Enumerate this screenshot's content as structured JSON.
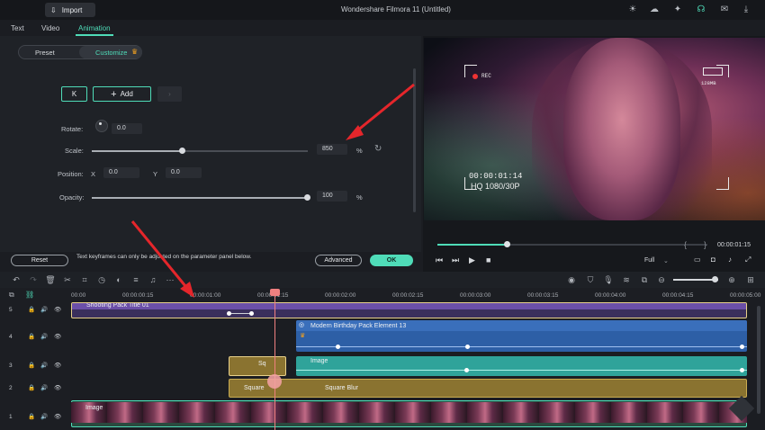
{
  "app": {
    "title": "Wondershare Filmora 11 (Untitled)",
    "import_label": "Import"
  },
  "top_tabs": [
    "Text",
    "Video",
    "Animation"
  ],
  "sub_tabs": {
    "preset": "Preset",
    "customize": "Customize"
  },
  "keyframe": {
    "prev_glyph": "K",
    "add_label": "Add",
    "next_glyph": "›"
  },
  "params": {
    "rotate_label": "Rotate:",
    "rotate_value": "0.0",
    "scale_label": "Scale:",
    "scale_value": "850",
    "scale_unit": "%",
    "position_label": "Position:",
    "x_label": "X",
    "x_value": "0.0",
    "y_label": "Y",
    "y_value": "0.0",
    "opacity_label": "Opacity:",
    "opacity_value": "100",
    "opacity_unit": "%"
  },
  "footer": {
    "reset_label": "Reset",
    "hint": "Text keyframes can only be adjusted on the parameter panel below.",
    "advanced_label": "Advanced",
    "ok_label": "OK"
  },
  "preview": {
    "rec": "REC",
    "timecode": "00:00:01:14",
    "quality": "HQ 1080/30P",
    "battery": "128MB",
    "current_time": "00:00:01:15",
    "zoom": "Full",
    "progress": 0.26
  },
  "ruler": [
    "00:00",
    "00:00:00:15",
    "00:00:01:00",
    "00:00:01:15",
    "00:00:02:00",
    "00:00:02:15",
    "00:00:03:00",
    "00:00:03:15",
    "00:00:04:00",
    "00:00:04:15",
    "00:00:05:00"
  ],
  "tracks": [
    {
      "num": "5",
      "clip": "Shooting Pack Title 01"
    },
    {
      "num": "4",
      "clip": "Modern Birthday Pack Element 13"
    },
    {
      "num": "3",
      "clip": "Image",
      "clip2": "Sq"
    },
    {
      "num": "2",
      "clip": "Square",
      "clip2": "Square Blur"
    },
    {
      "num": "1",
      "clip": "Image"
    }
  ],
  "colors": {
    "accent": "#4fdcb8",
    "purple_clip": "#6b4fa8",
    "blue_clip": "#2d5fa6",
    "teal_clip": "#2fa39a",
    "gold_clip": "#8a7330",
    "arrow": "#e5262b"
  }
}
